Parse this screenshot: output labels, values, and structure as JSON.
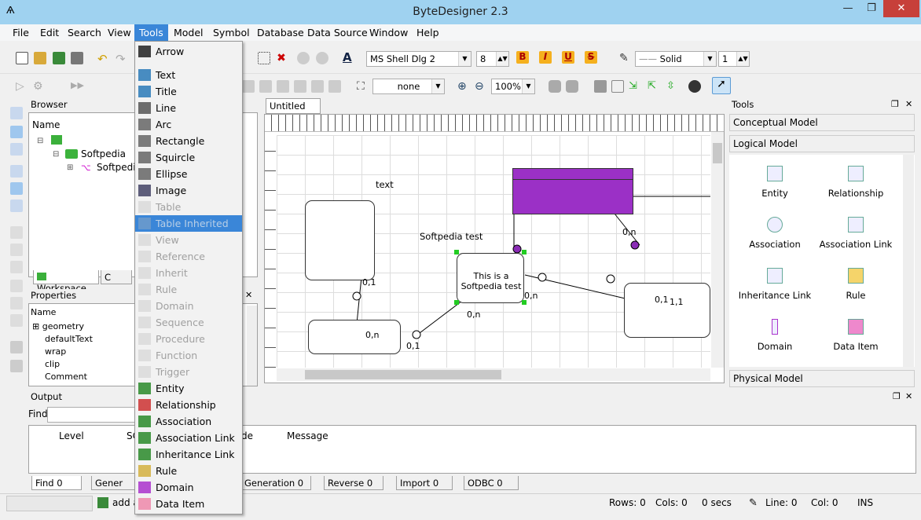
{
  "window": {
    "title": "ByteDesigner 2.3",
    "min": "—",
    "max": "❐",
    "close": "✕"
  },
  "menubar": [
    "File",
    "Edit",
    "Search",
    "View",
    "Tools",
    "Model",
    "Symbol",
    "Database",
    "Data Source",
    "Window",
    "Help"
  ],
  "toolbar": {
    "font": "MS Shell Dlg 2",
    "size": "8",
    "line_style": "Solid",
    "line_width": "1",
    "fill": "none",
    "zoom": "100%"
  },
  "browser": {
    "title": "Browser",
    "col": "Name",
    "root": "Softpedia",
    "child": "Softpedia",
    "tab_workspace": "Workspace",
    "tab2": "C"
  },
  "properties": {
    "title": "Properties",
    "col": "Name",
    "rows": [
      "geometry",
      "defaultText",
      "wrap",
      "clip",
      "Comment"
    ]
  },
  "output": {
    "title": "Output",
    "find_label": "Find",
    "cols": [
      "Level",
      "SC",
      "de",
      "Message"
    ],
    "tabs": [
      "Find 0",
      "Gener",
      "Generation 0",
      "Reverse 0",
      "Import 0",
      "ODBC 0"
    ]
  },
  "editor": {
    "tab": "Untitled",
    "labels": {
      "text": "text",
      "softpedia_test": "Softpedia test",
      "entity_text": "This is a Softpedia test",
      "c1": "0,1",
      "c2": "0,n",
      "c3": "0,1",
      "c4": "0,n",
      "c5": "0,n",
      "c6": "0,n",
      "c7": "0,1",
      "c8": "1,1",
      "c9": "0,n"
    }
  },
  "tools_panel": {
    "title": "Tools",
    "conceptual": "Conceptual Model",
    "logical": "Logical Model",
    "physical": "Physical Model",
    "items": [
      "Entity",
      "Relationship",
      "Association",
      "Association Link",
      "Inheritance Link",
      "Rule",
      "Domain",
      "Data Item"
    ]
  },
  "tools_menu": [
    {
      "label": "Arrow",
      "dis": false
    },
    {
      "label": "Text",
      "dis": false
    },
    {
      "label": "Title",
      "dis": false
    },
    {
      "label": "Line",
      "dis": false
    },
    {
      "label": "Arc",
      "dis": false
    },
    {
      "label": "Rectangle",
      "dis": false
    },
    {
      "label": "Squircle",
      "dis": false
    },
    {
      "label": "Ellipse",
      "dis": false
    },
    {
      "label": "Image",
      "dis": false
    },
    {
      "label": "Table",
      "dis": true
    },
    {
      "label": "Table Inherited",
      "dis": true,
      "hl": true
    },
    {
      "label": "View",
      "dis": true
    },
    {
      "label": "Reference",
      "dis": true
    },
    {
      "label": "Inherit",
      "dis": true
    },
    {
      "label": "Rule",
      "dis": true
    },
    {
      "label": "Domain",
      "dis": true
    },
    {
      "label": "Sequence",
      "dis": true
    },
    {
      "label": "Procedure",
      "dis": true
    },
    {
      "label": "Function",
      "dis": true
    },
    {
      "label": "Trigger",
      "dis": true
    },
    {
      "label": "Entity",
      "dis": false
    },
    {
      "label": "Relationship",
      "dis": false
    },
    {
      "label": "Association",
      "dis": false
    },
    {
      "label": "Association Link",
      "dis": false
    },
    {
      "label": "Inheritance Link",
      "dis": false
    },
    {
      "label": "Rule",
      "dis": false
    },
    {
      "label": "Domain",
      "dis": false
    },
    {
      "label": "Data Item",
      "dis": false
    }
  ],
  "statusbar": {
    "task": "add a",
    "rows": "Rows: 0",
    "cols": "Cols: 0",
    "secs": "0 secs",
    "line": "Line: 0",
    "col": "Col: 0",
    "mode": "INS"
  },
  "colors": {
    "accent": "#3a86d8",
    "purple": "#9b30c6",
    "titlebar": "#9fd2f0"
  }
}
